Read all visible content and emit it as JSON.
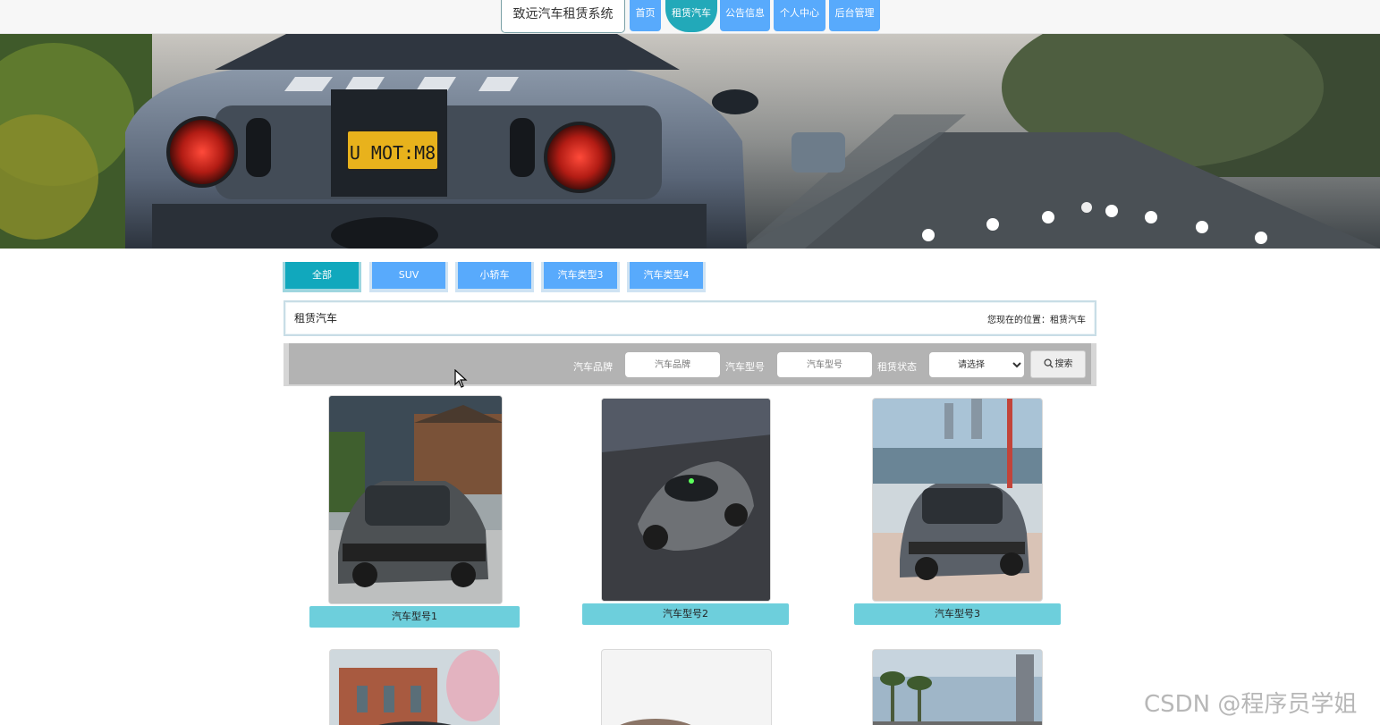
{
  "brand": "致远汽车租赁系统",
  "nav": [
    "首页",
    "租赁汽车",
    "公告信息",
    "个人中心",
    "后台管理"
  ],
  "nav_active": 1,
  "categories": [
    "全部",
    "SUV",
    "小轿车",
    "汽车类型3",
    "汽车类型4"
  ],
  "category_active": 0,
  "section_title": "租赁汽车",
  "location_prefix": "您现在的位置：",
  "location_current": "租赁汽车",
  "search": {
    "brand_label": "汽车品牌",
    "brand_placeholder": "汽车品牌",
    "model_label": "汽车型号",
    "model_placeholder": "汽车型号",
    "status_label": "租赁状态",
    "status_selected": "请选择",
    "button_label": "搜索",
    "button_icon": "search-icon"
  },
  "cars": [
    {
      "name": "汽车型号1"
    },
    {
      "name": "汽车型号2"
    },
    {
      "name": "汽车型号3"
    }
  ],
  "banner_plate": "U MOT:M8",
  "watermark": "CSDN @程序员学姐",
  "colors": {
    "nav_blue": "#58aafc",
    "nav_active_teal": "#22a9b9",
    "tab_active": "#11a8bd",
    "card_label": "#6dcfdc",
    "search_bar": "#b3b3b3"
  }
}
